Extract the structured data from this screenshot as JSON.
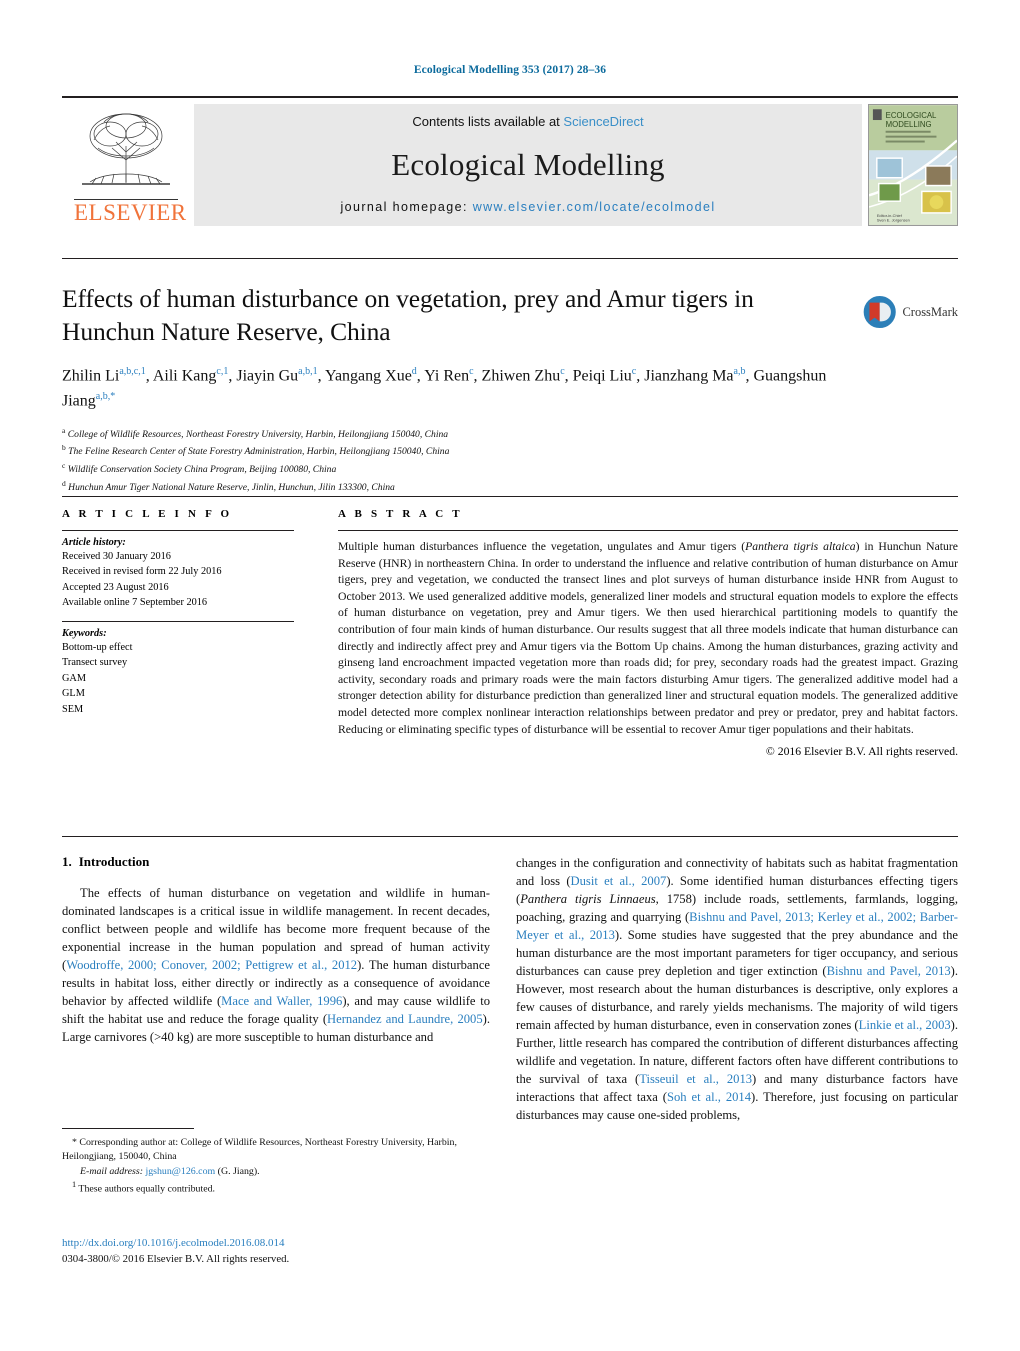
{
  "running_head": "Ecological Modelling 353 (2017) 28–36",
  "masthead": {
    "contents_prefix": "Contents lists available at",
    "contents_link": "ScienceDirect",
    "journal_name": "Ecological Modelling",
    "homepage_prefix": "journal homepage:",
    "homepage_url": "www.elsevier.com/locate/ecolmodel",
    "publisher": "ELSEVIER",
    "cover_title_line1": "ECOLOGICAL",
    "cover_title_line2": "MODELLING"
  },
  "crossmark": {
    "label": "CrossMark"
  },
  "article": {
    "title": "Effects of human disturbance on vegetation, prey and Amur tigers in Hunchun Nature Reserve, China",
    "authors": [
      {
        "name": "Zhilin Li",
        "sup": "a,b,c,1",
        "sep": ", "
      },
      {
        "name": "Aili Kang",
        "sup": "c,1",
        "sep": ", "
      },
      {
        "name": "Jiayin Gu",
        "sup": "a,b,1",
        "sep": ", "
      },
      {
        "name": "Yangang Xue",
        "sup": "d",
        "sep": ", "
      },
      {
        "name": "Yi Ren",
        "sup": "c",
        "sep": ", "
      },
      {
        "name": "Zhiwen Zhu",
        "sup": "c",
        "sep": ", "
      },
      {
        "name": "Peiqi Liu",
        "sup": "c",
        "sep": ", "
      },
      {
        "name": "Jianzhang Ma",
        "sup": "a,b",
        "sep": ", "
      },
      {
        "name": "Guangshun Jiang",
        "sup": "a,b,*",
        "sep": ""
      }
    ],
    "affiliations": [
      {
        "marker": "a",
        "text": "College of Wildlife Resources, Northeast Forestry University, Harbin, Heilongjiang 150040, China"
      },
      {
        "marker": "b",
        "text": "The Feline Research Center of State Forestry Administration, Harbin, Heilongjiang 150040, China"
      },
      {
        "marker": "c",
        "text": "Wildlife Conservation Society China Program, Beijing 100080, China"
      },
      {
        "marker": "d",
        "text": "Hunchun Amur Tiger National Nature Reserve, Jinlin, Hunchun, Jilin 133300, China"
      }
    ]
  },
  "article_info": {
    "heading": "A R T I C L E   I N F O",
    "history_label": "Article history:",
    "history": [
      "Received 30 January 2016",
      "Received in revised form 22 July 2016",
      "Accepted 23 August 2016",
      "Available online 7 September 2016"
    ],
    "keywords_label": "Keywords:",
    "keywords": [
      "Bottom-up effect",
      "Transect survey",
      "GAM",
      "GLM",
      "SEM"
    ]
  },
  "abstract": {
    "heading": "A B S T R A C T",
    "paragraph_part1": "Multiple human disturbances influence the vegetation, ungulates and Amur tigers (",
    "species_italic": "Panthera tigris altaica",
    "paragraph_part2": ") in Hunchun Nature Reserve (HNR) in northeastern China. In order to understand the influence and relative contribution of human disturbance on Amur tigers, prey and vegetation, we conducted the transect lines and plot surveys of human disturbance inside HNR from August to October 2013. We used generalized additive models, generalized liner models and structural equation models to explore the effects of human disturbance on vegetation, prey and Amur tigers. We then used hierarchical partitioning models to quantify the contribution of four main kinds of human disturbance. Our results suggest that all three models indicate that human disturbance can directly and indirectly affect prey and Amur tigers via the Bottom Up chains. Among the human disturbances, grazing activity and ginseng land encroachment impacted vegetation more than roads did; for prey, secondary roads had the greatest impact. Grazing activity, secondary roads and primary roads were the main factors disturbing Amur tigers. The generalized additive model had a stronger detection ability for disturbance prediction than generalized liner and structural equation models. The generalized additive model detected more complex nonlinear interaction relationships between predator and prey or predator, prey and habitat factors. Reducing or eliminating specific types of disturbance will be essential to recover Amur tiger populations and their habitats.",
    "copyright": "© 2016 Elsevier B.V. All rights reserved."
  },
  "introduction": {
    "number": "1.",
    "title": "Introduction",
    "left_p1_a": "The effects of human disturbance on vegetation and wildlife in human-dominated landscapes is a critical issue in wildlife management. In recent decades, conflict between people and wildlife has become more frequent because of the exponential increase in the human population and spread of human activity (",
    "left_ref1": "Woodroffe, 2000; Conover, 2002; Pettigrew et al., 2012",
    "left_p1_b": "). The human disturbance results in habitat loss, either directly or indirectly as a consequence of avoidance behavior by affected wildlife (",
    "left_ref2": "Mace and Waller, 1996",
    "left_p1_c": "), and may cause wildlife to shift the habitat use and reduce the forage quality (",
    "left_ref3": "Hernandez and Laundre, 2005",
    "left_p1_d": "). Large carnivores (>40 kg) are more susceptible to human disturbance and",
    "right_a": "changes in the configuration and connectivity of habitats such as habitat fragmentation and loss (",
    "right_ref1": "Dusit et al., 2007",
    "right_b": "). Some identified human disturbances effecting tigers (",
    "right_italic1": "Panthera tigris Linnaeus",
    "right_c": ", 1758) include roads, settlements, farmlands, logging, poaching, grazing and quarrying (",
    "right_ref2": "Bishnu and Pavel, 2013; Kerley et al., 2002; Barber-Meyer et al., 2013",
    "right_d": "). Some studies have suggested that the prey abundance and the human disturbance are the most important parameters for tiger occupancy, and serious disturbances can cause prey depletion and tiger extinction (",
    "right_ref3": "Bishnu and Pavel, 2013",
    "right_e": "). However, most research about the human disturbances is descriptive, only explores a few causes of disturbance, and rarely yields mechanisms. The majority of wild tigers remain affected by human disturbance, even in conservation zones (",
    "right_ref4": "Linkie et al., 2003",
    "right_f": "). Further, little research has compared the contribution of different disturbances affecting wildlife and vegetation. In nature, different factors often have different contributions to the survival of taxa (",
    "right_ref5": "Tisseuil et al., 2013",
    "right_g": ") and many disturbance factors have interactions that affect taxa (",
    "right_ref6": "Soh et al., 2014",
    "right_h": "). Therefore, just focusing on particular disturbances may cause one-sided problems,"
  },
  "footnotes": {
    "corresponding": "* Corresponding author at: College of Wildlife Resources, Northeast Forestry University, Harbin, Heilongjiang, 150040, China",
    "email_label": "E-mail address:",
    "email": "jgshun@126.com",
    "email_suffix": "(G. Jiang).",
    "equal_marker": "1",
    "equal_text": "These authors equally contributed."
  },
  "doi": {
    "url": "http://dx.doi.org/10.1016/j.ecolmodel.2016.08.014",
    "issn_line": "0304-3800/© 2016 Elsevier B.V. All rights reserved."
  },
  "colors": {
    "link_blue": "#2a7fbf",
    "header_blue": "#0b6a9c",
    "elsevier_orange": "#f0733a",
    "banner_gray": "#e8e8e8"
  }
}
